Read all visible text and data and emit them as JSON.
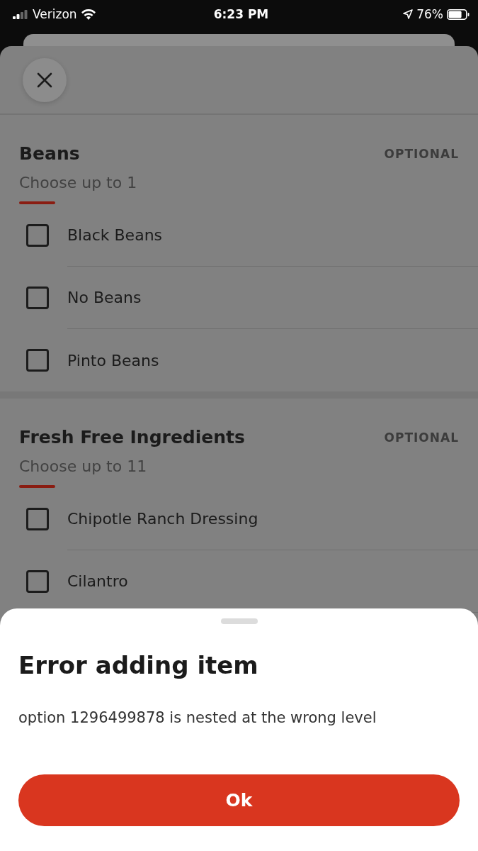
{
  "status_bar": {
    "carrier": "Verizon",
    "time": "6:23 PM",
    "battery": "76%"
  },
  "sections": [
    {
      "title": "Beans",
      "badge": "OPTIONAL",
      "subtitle": "Choose up to 1",
      "options": [
        {
          "label": "Black Beans",
          "checked": false
        },
        {
          "label": "No Beans",
          "checked": false
        },
        {
          "label": "Pinto Beans",
          "checked": false
        }
      ]
    },
    {
      "title": "Fresh Free Ingredients",
      "badge": "OPTIONAL",
      "subtitle": "Choose up to 11",
      "options": [
        {
          "label": "Chipotle Ranch Dressing",
          "checked": false
        },
        {
          "label": "Cilantro",
          "checked": false
        }
      ]
    }
  ],
  "dialog": {
    "title": "Error adding item",
    "message": "option 1296499878 is nested at the wrong level",
    "button": "Ok"
  }
}
